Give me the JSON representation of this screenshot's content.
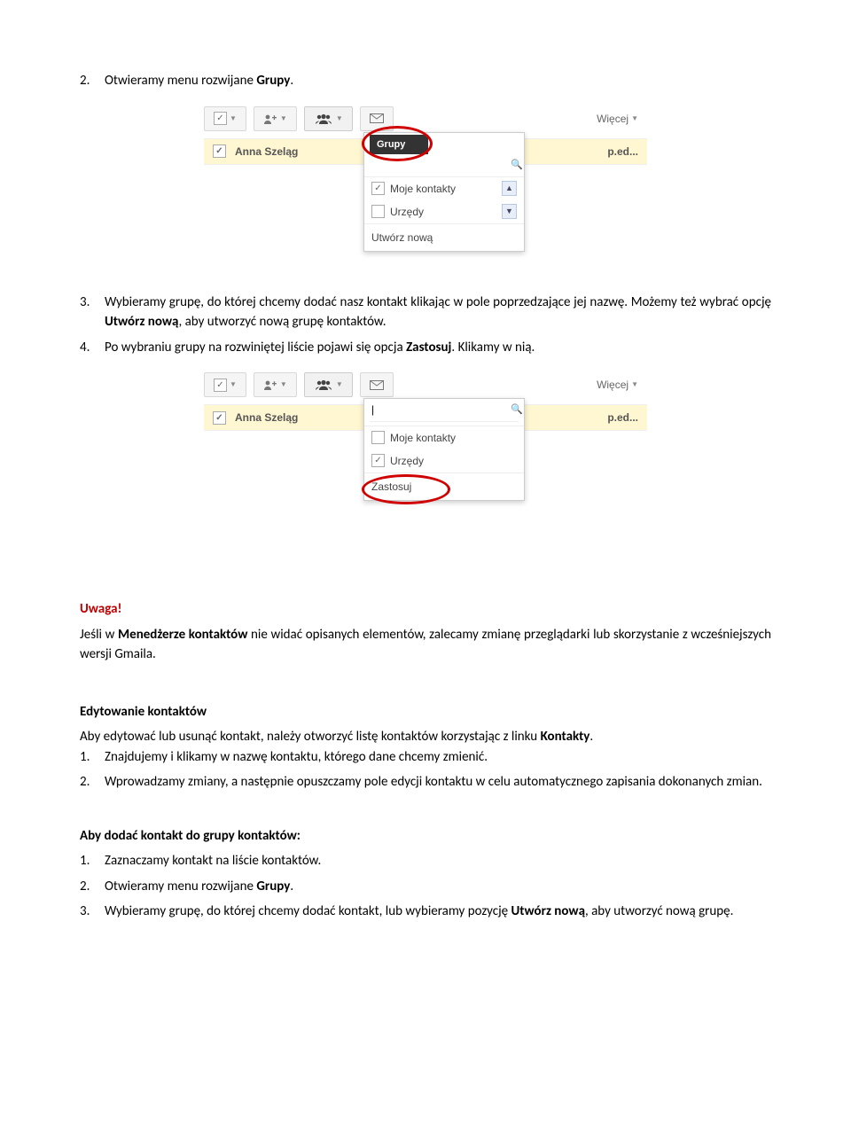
{
  "step2": {
    "num": "2.",
    "pre": "Otwieramy menu rozwijane ",
    "bold": "Grupy",
    "post": "."
  },
  "shot1": {
    "toolbar_more": "Więcej",
    "contact_name": "Anna Szeląg",
    "contact_right": "p.ed...",
    "dd_title": "Grupy",
    "dd_items": [
      {
        "label": "Moje kontakty",
        "checked": true,
        "scroll": "up"
      },
      {
        "label": "Urzędy",
        "checked": false,
        "scroll": "down"
      }
    ],
    "dd_foot": "Utwórz nową"
  },
  "step3": {
    "num": "3.",
    "text": "Wybieramy grupę, do której chcemy dodać nasz kontakt klikając w pole poprzedzające jej nazwę. Możemy też wybrać opcję ",
    "bold": "Utwórz nową",
    "post": ", aby utworzyć nową grupę kontaktów."
  },
  "step4": {
    "num": "4.",
    "pre": "Po wybraniu grupy na rozwiniętej liście pojawi się opcja ",
    "bold": "Zastosuj",
    "post": ". Klikamy w nią."
  },
  "shot2": {
    "toolbar_more": "Więcej",
    "contact_name": "Anna Szeląg",
    "contact_right": "p.ed...",
    "dd_items": [
      {
        "label": "Moje kontakty",
        "checked": false
      },
      {
        "label": "Urzędy",
        "checked": true
      }
    ],
    "dd_foot": "Zastosuj"
  },
  "uwaga": {
    "title": "Uwaga!",
    "pre": "Jeśli w ",
    "bold": "Menedżerze kontaktów",
    "post": " nie widać opisanych elementów, zalecamy zmianę przeglądarki lub skorzystanie z wcześniejszych wersji Gmaila."
  },
  "edit": {
    "title": "Edytowanie kontaktów",
    "intro_pre": "Aby edytować lub usunąć kontakt, należy otworzyć listę kontaktów korzystając z linku ",
    "intro_bold": "Kontakty",
    "intro_post": ".",
    "s1": {
      "num": "1.",
      "text": "Znajdujemy i klikamy w nazwę kontaktu, którego dane chcemy zmienić."
    },
    "s2": {
      "num": "2.",
      "text": "Wprowadzamy zmiany, a następnie opuszczamy pole edycji kontaktu w celu automatycznego zapisania dokonanych zmian."
    }
  },
  "addgroup": {
    "title": "Aby dodać kontakt do grupy kontaktów:",
    "s1": {
      "num": "1.",
      "text": "Zaznaczamy kontakt na liście kontaktów."
    },
    "s2": {
      "num": "2.",
      "pre": "Otwieramy menu rozwijane ",
      "bold": "Grupy",
      "post": "."
    },
    "s3": {
      "num": "3.",
      "pre": "Wybieramy grupę, do której chcemy dodać kontakt, lub wybieramy pozycję ",
      "bold": "Utwórz nową",
      "post": ", aby utworzyć nową grupę."
    }
  }
}
